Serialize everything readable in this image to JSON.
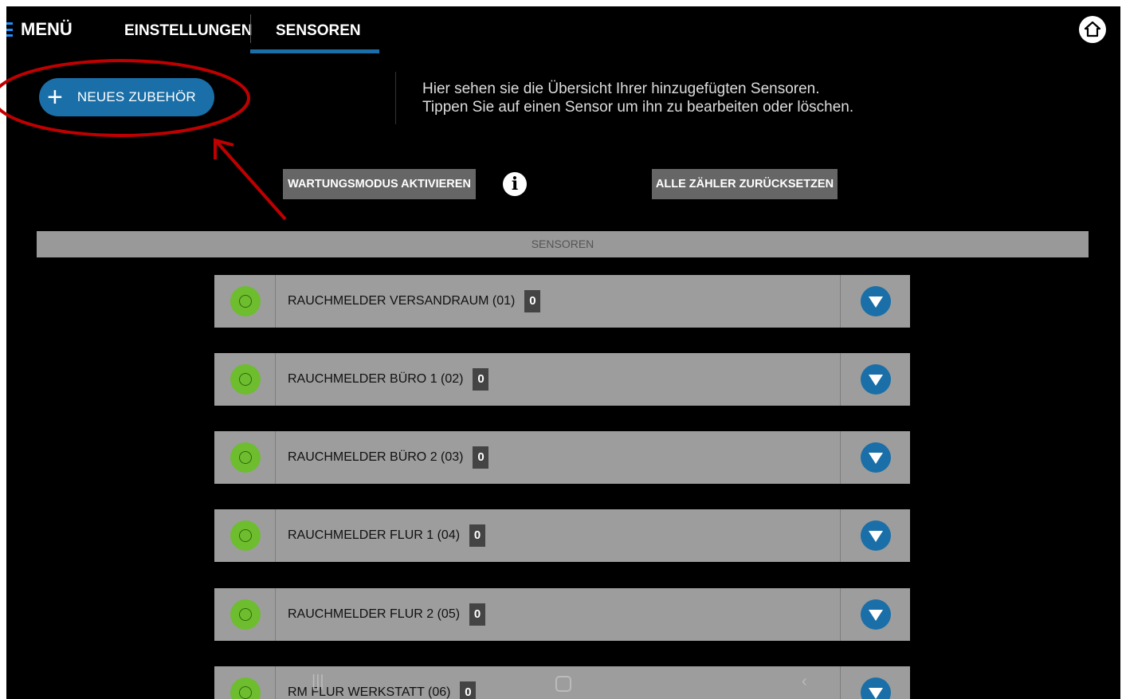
{
  "topbar": {
    "menu_label": "MENÜ",
    "tabs": [
      {
        "label": "EINSTELLUNGEN",
        "active": false
      },
      {
        "label": "SENSOREN",
        "active": true
      }
    ]
  },
  "main": {
    "new_button_label": "NEUES ZUBEHÖR",
    "info_text_line1": "Hier sehen sie die Übersicht Ihrer hinzugefügten Sensoren.",
    "info_text_line2": "Tippen Sie auf einen Sensor um ihn zu bearbeiten oder löschen.",
    "maintenance_button": "WARTUNGSMODUS AKTIVIEREN",
    "info_icon": "i",
    "reset_button": "ALLE ZÄHLER ZURÜCKSETZEN",
    "section_title": "SENSOREN"
  },
  "sensors": [
    {
      "name": "RAUCHMELDER VERSANDRAUM (01)",
      "count": "0",
      "status": "ok"
    },
    {
      "name": "RAUCHMELDER BÜRO 1 (02)",
      "count": "0",
      "status": "ok"
    },
    {
      "name": "RAUCHMELDER BÜRO 2 (03)",
      "count": "0",
      "status": "ok"
    },
    {
      "name": "RAUCHMELDER FLUR 1 (04)",
      "count": "0",
      "status": "ok"
    },
    {
      "name": "RAUCHMELDER FLUR 2 (05)",
      "count": "0",
      "status": "ok"
    },
    {
      "name": "RM FLUR WERKSTATT (06)",
      "count": "0",
      "status": "ok"
    }
  ],
  "android_nav": {
    "recent": "|||",
    "back": "‹"
  },
  "colors": {
    "accent": "#1a6fa8",
    "status_ok": "#6dbd2e",
    "annotation": "#c00000"
  }
}
